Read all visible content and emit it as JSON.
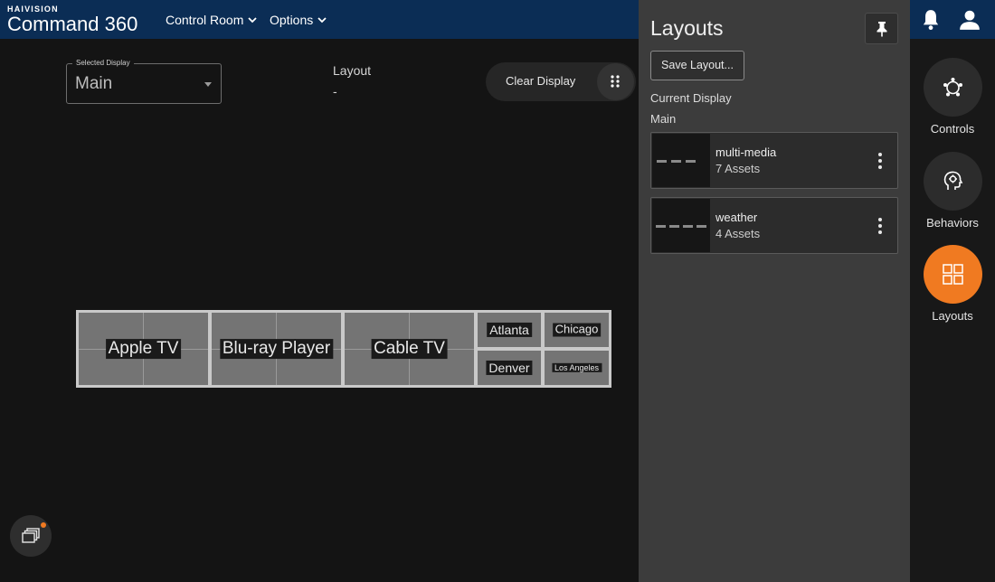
{
  "header": {
    "brand_small": "HAIVISION",
    "brand_big": "Command 360",
    "menus": [
      {
        "label": "Control Room"
      },
      {
        "label": "Options"
      }
    ],
    "notification_icon": "bell-icon",
    "user_icon": "user-icon",
    "background_color": "#0b2d55"
  },
  "display": {
    "selected_label": "Selected Display",
    "selected_value": "Main",
    "layout_label": "Layout",
    "layout_value": "-",
    "clear_label": "Clear Display",
    "grip_icon": "grip-icon"
  },
  "wall": {
    "tiles": [
      {
        "label": "Apple TV"
      },
      {
        "label": "Blu-ray Player"
      },
      {
        "label": "Cable TV"
      },
      {
        "label": "Atlanta"
      },
      {
        "label": "Chicago"
      },
      {
        "label": "Denver"
      },
      {
        "label": "Los Angeles"
      }
    ]
  },
  "panel": {
    "title": "Layouts",
    "pin_icon": "pin-icon",
    "save_label": "Save Layout...",
    "current_label": "Current Display",
    "current_value": "Main",
    "layouts": [
      {
        "name": "multi-media",
        "count": "7 Assets"
      },
      {
        "name": "weather",
        "count": "4 Assets"
      }
    ]
  },
  "rail": {
    "items": [
      {
        "label": "Controls",
        "icon": "controls-icon",
        "active": false
      },
      {
        "label": "Behaviors",
        "icon": "behaviors-icon",
        "active": false
      },
      {
        "label": "Layouts",
        "icon": "layouts-icon",
        "active": true
      }
    ],
    "accent_color": "#f07a21"
  },
  "chat": {
    "icon": "windows-stack-icon",
    "badge_color": "#f07a21"
  }
}
